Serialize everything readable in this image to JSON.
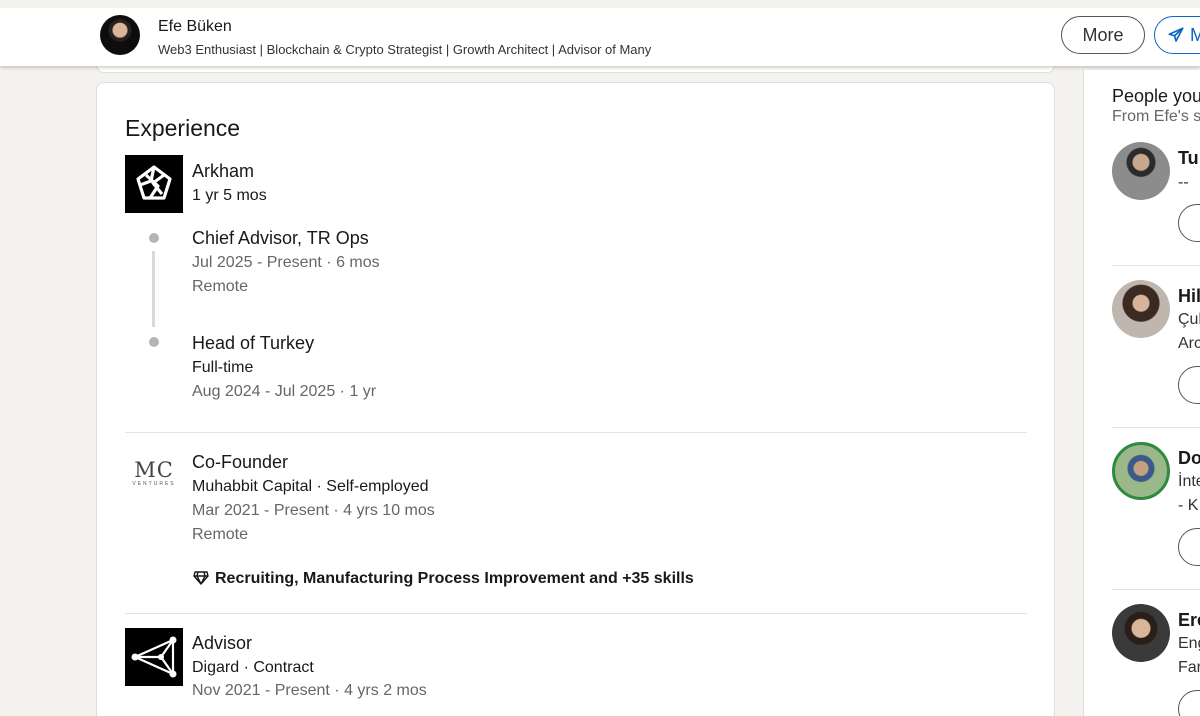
{
  "header": {
    "name": "Efe Büken",
    "headline": "Web3 Enthusiast | Blockchain & Crypto Strategist | Growth Architect | Advisor of Many",
    "more_label": "More",
    "message_label": "M"
  },
  "experience": {
    "title": "Experience",
    "arkham": {
      "company": "Arkham",
      "duration": "1 yr 5 mos",
      "roles": [
        {
          "title": "Chief Advisor, TR Ops",
          "dates": "Jul 2025 - Present · 6 mos",
          "location": "Remote"
        },
        {
          "title": "Head of Turkey",
          "type": "Full-time",
          "dates": "Aug 2024 - Jul 2025 · 1 yr"
        }
      ]
    },
    "cofounder": {
      "title": "Co-Founder",
      "company": "Muhabbit Capital · Self-employed",
      "dates": "Mar 2021 - Present · 4 yrs 10 mos",
      "location": "Remote",
      "skills": "Recruiting, Manufacturing Process Improvement and +35 skills",
      "logo_text": "MC",
      "logo_sub": "VENTURES"
    },
    "advisor": {
      "title": "Advisor",
      "company": "Digard · Contract",
      "dates": "Nov 2021 - Present · 4 yrs 2 mos"
    }
  },
  "rail": {
    "title": "People you",
    "subtitle": "From Efe's s",
    "people": [
      {
        "name": "Tu",
        "line1": "--",
        "line2": ""
      },
      {
        "name": "Hil",
        "line1": "Çul",
        "line2": "Arc"
      },
      {
        "name": "Do",
        "line1": "İnte",
        "line2": "- K"
      },
      {
        "name": "Ere",
        "line1": "Eng",
        "line2": "Far"
      }
    ]
  }
}
